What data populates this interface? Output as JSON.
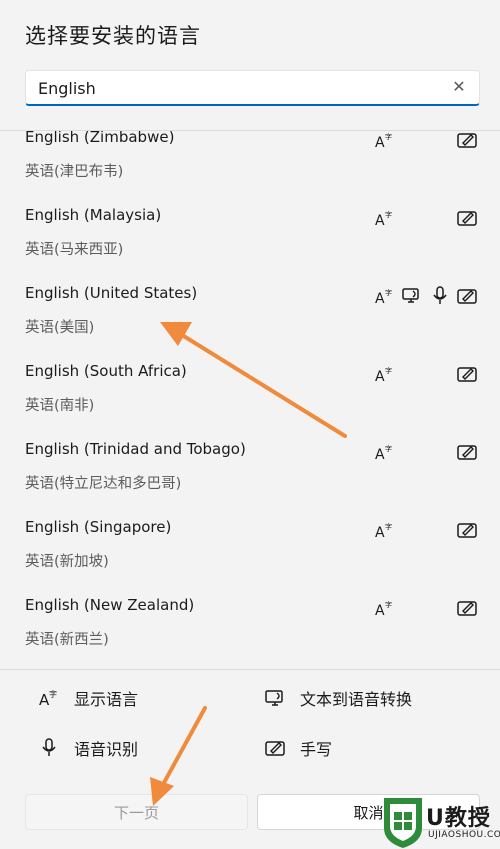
{
  "dialog": {
    "title": "选择要安装的语言",
    "search": {
      "value": "English",
      "clear_icon": "close-icon"
    }
  },
  "languages": [
    {
      "name": "English (Zimbabwe)",
      "native": "英语(津巴布韦)",
      "features": [
        "display",
        "handwriting"
      ]
    },
    {
      "name": "English (Malaysia)",
      "native": "英语(马来西亚)",
      "features": [
        "display",
        "handwriting"
      ]
    },
    {
      "name": "English (United States)",
      "native": "英语(美国)",
      "features": [
        "display",
        "tts",
        "speech",
        "handwriting"
      ]
    },
    {
      "name": "English (South Africa)",
      "native": "英语(南非)",
      "features": [
        "display",
        "handwriting"
      ]
    },
    {
      "name": "English (Trinidad and Tobago)",
      "native": "英语(特立尼达和多巴哥)",
      "features": [
        "display",
        "handwriting"
      ]
    },
    {
      "name": "English (Singapore)",
      "native": "英语(新加坡)",
      "features": [
        "display",
        "handwriting"
      ]
    },
    {
      "name": "English (New Zealand)",
      "native": "英语(新西兰)",
      "features": [
        "display",
        "handwriting"
      ]
    }
  ],
  "legend": {
    "display": "显示语言",
    "tts": "文本到语音转换",
    "speech": "语音识别",
    "handwriting": "手写"
  },
  "buttons": {
    "next": "下一页",
    "cancel": "取消"
  },
  "watermark": {
    "brand": "U教授",
    "url": "UJIAOSHOU.COM"
  },
  "annotation_color": "#f08a3c"
}
